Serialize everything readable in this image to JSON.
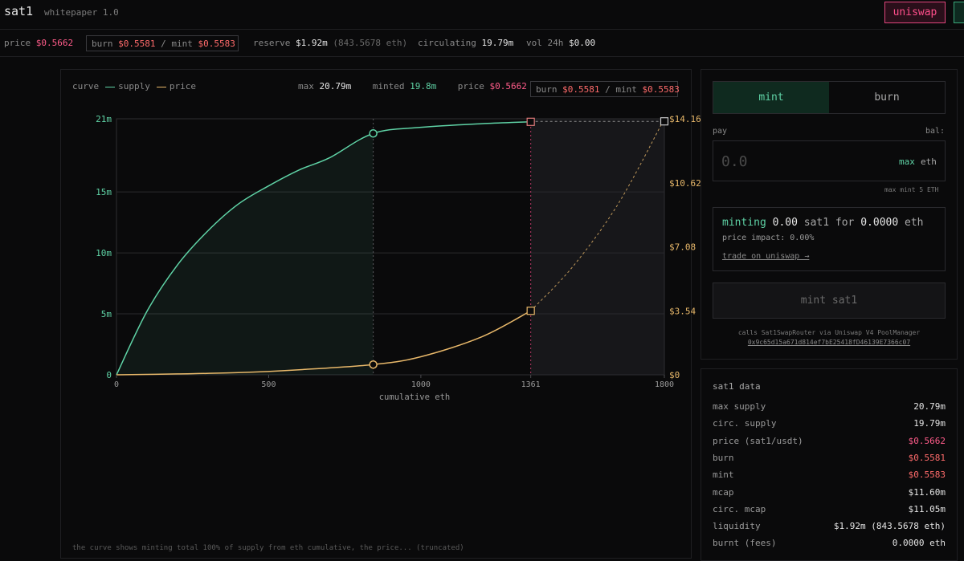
{
  "header": {
    "brand": "sat1",
    "whitepaper_link": "whitepaper 1.0",
    "uniswap_button": "uniswap"
  },
  "stats": {
    "price_label": "price",
    "price_value": "$0.5662",
    "burn_label": "burn",
    "burn_value": "$0.5581",
    "mint_sep": "/ mint",
    "mint_value": "$0.5583",
    "reserve_label": "reserve",
    "reserve_value": "$1.92m",
    "reserve_eth": "(843.5678 eth)",
    "circulating_label": "circulating",
    "circulating_value": "19.79m",
    "vol_label": "vol 24h",
    "vol_value": "$0.00"
  },
  "chart_header": {
    "curve_label": "curve",
    "supply_label": "supply",
    "price_label": "price",
    "max_label": "max",
    "max_value": "20.79m",
    "minted_label": "minted",
    "minted_value": "19.8m",
    "price_stat_label": "price",
    "price_stat_value": "$0.5662",
    "burn_label": "burn",
    "burn_value": "$0.5581",
    "mint_sep": "/ mint",
    "mint_value": "$0.5583"
  },
  "chart_data": {
    "type": "line",
    "xlabel": "cumulative eth",
    "xlim": [
      0,
      1800
    ],
    "x_ticks": [
      0,
      500,
      1000,
      1361,
      1800
    ],
    "ylim_left": [
      0,
      21
    ],
    "y_left_ticks": [
      "0",
      "5m",
      "10m",
      "15m",
      "21m"
    ],
    "y_left_tick_values": [
      0,
      5,
      10,
      15,
      21
    ],
    "ylim_right": [
      0,
      14.16
    ],
    "y_right_ticks": [
      "$0",
      "$3.54",
      "$7.08",
      "$10.62",
      "$14.16"
    ],
    "y_right_tick_values": [
      0,
      3.54,
      7.08,
      10.62,
      14.16
    ],
    "grid": true,
    "markers_x": {
      "current": 843.5678,
      "mint_limit": 1361,
      "end": 1800
    },
    "series": [
      {
        "name": "supply",
        "color": "#5fd3a6",
        "axis": "left",
        "x": [
          0,
          100,
          200,
          300,
          400,
          500,
          600,
          700,
          843.57,
          1000,
          1200,
          1361,
          1500,
          1800
        ],
        "values": [
          0,
          5.2,
          9.0,
          11.8,
          14.0,
          15.5,
          16.8,
          17.8,
          19.8,
          20.3,
          20.6,
          20.75,
          20.78,
          20.79
        ]
      },
      {
        "name": "price",
        "color": "#e8b86a",
        "axis": "right",
        "x": [
          0,
          200,
          400,
          600,
          843.57,
          1000,
          1200,
          1361,
          1500,
          1650,
          1800
        ],
        "values": [
          0,
          0.05,
          0.12,
          0.28,
          0.5662,
          1.0,
          2.1,
          3.54,
          6.0,
          9.5,
          14.16
        ]
      }
    ]
  },
  "chart_footer_text": "the curve shows minting total 100% of supply from eth cumulative, the price... (truncated)",
  "trade": {
    "mint_tab": "mint",
    "burn_tab": "burn",
    "pay_label": "pay",
    "bal_label": "bal:",
    "pay_placeholder": "0.0",
    "max_label": "max",
    "unit_label": "eth",
    "max_mint_note": "max mint 5 ETH",
    "minting_word": "minting",
    "minting_amount": "0.00",
    "minting_token": "sat1",
    "for_word": "for",
    "minting_cost": "0.0000",
    "minting_unit": "eth",
    "price_impact": "price impact: 0.00%",
    "trade_link": "trade on uniswap →",
    "mint_button": "mint sat1",
    "calls_note": "calls Sat1SwapRouter via Uniswap V4 PoolManager",
    "router_address": "0x9c65d15a671d814ef7bE25418fD46139E7366c07"
  },
  "sat1_data": {
    "title": "sat1 data",
    "rows": [
      {
        "key": "max supply",
        "value": "20.79m",
        "tone": ""
      },
      {
        "key": "circ. supply",
        "value": "19.79m",
        "tone": ""
      },
      {
        "key": "price (sat1/usdt)",
        "value": "$0.5662",
        "tone": "pink"
      },
      {
        "key": "burn",
        "value": "$0.5581",
        "tone": "red"
      },
      {
        "key": "mint",
        "value": "$0.5583",
        "tone": "red"
      },
      {
        "key": "mcap",
        "value": "$11.60m",
        "tone": ""
      },
      {
        "key": "circ. mcap",
        "value": "$11.05m",
        "tone": ""
      },
      {
        "key": "liquidity",
        "value": "$1.92m (843.5678 eth)",
        "tone": ""
      },
      {
        "key": "burnt (fees)",
        "value": "0.0000 eth",
        "tone": ""
      }
    ]
  }
}
